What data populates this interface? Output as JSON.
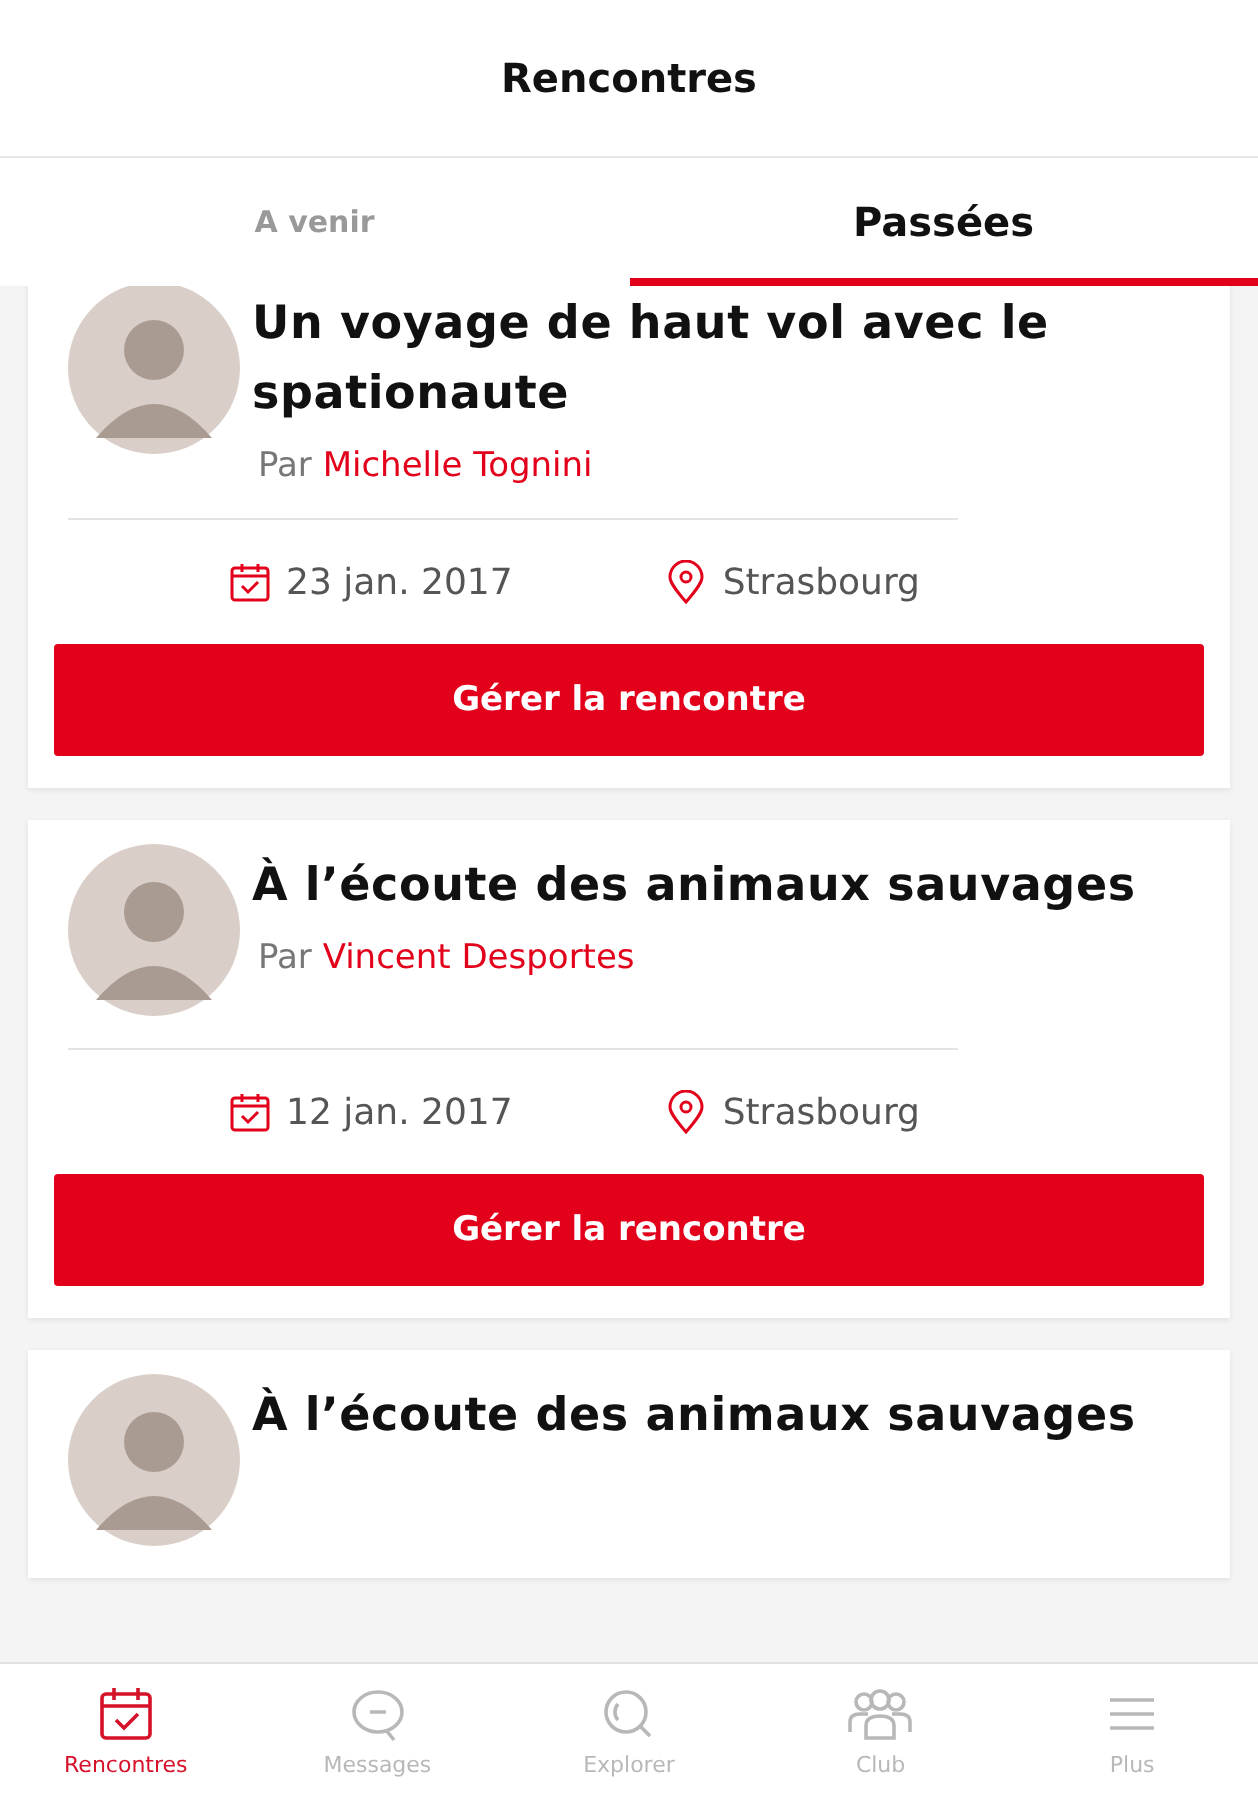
{
  "header": {
    "title": "Rencontres"
  },
  "tabs": [
    {
      "label": "A venir",
      "selected": false
    },
    {
      "label": "Passées",
      "selected": true
    }
  ],
  "meetings": [
    {
      "title": "Un voyage de haut vol avec le spationaute",
      "author_prefix": "Par",
      "author": "Michelle Tognini",
      "date": "23 jan. 2017",
      "place": "Strasbourg",
      "button": "Gérer la rencontre"
    },
    {
      "title": "À l’écoute des animaux sauvages",
      "author_prefix": "Par",
      "author": "Vincent Desportes",
      "date": "12 jan. 2017",
      "place": "Strasbourg",
      "button": "Gérer la rencontre"
    },
    {
      "title": "À l’écoute des animaux sauvages"
    }
  ],
  "nav": [
    {
      "kind": "calendar",
      "label": "Rencontres",
      "selected": true
    },
    {
      "kind": "chat",
      "label": "Messages",
      "selected": false
    },
    {
      "kind": "search",
      "label": "Explorer",
      "selected": false
    },
    {
      "kind": "group",
      "label": "Club",
      "selected": false
    },
    {
      "kind": "menu",
      "label": "Plus",
      "selected": false
    }
  ]
}
